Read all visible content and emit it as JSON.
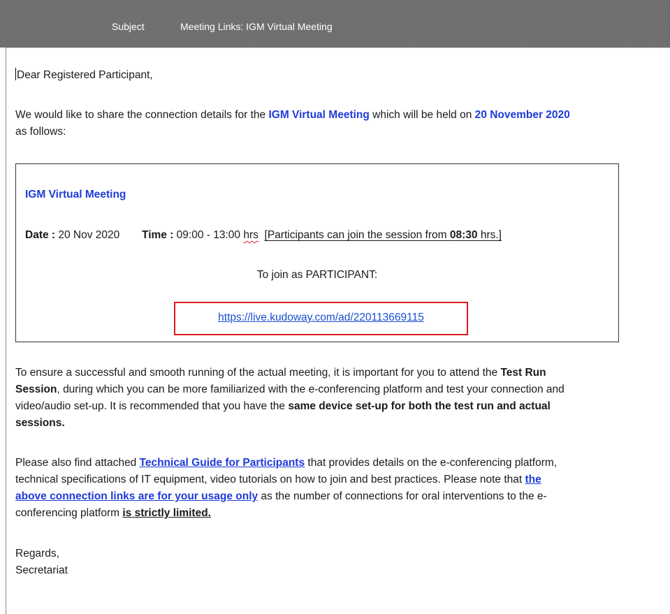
{
  "header": {
    "subject_label": "Subject",
    "subject_value": "Meeting Links: IGM Virtual Meeting"
  },
  "email": {
    "greeting": "Dear Registered Participant,",
    "intro": {
      "part1": "We would like to share the connection details for the ",
      "meeting_name": "IGM Virtual Meeting",
      "part2": " which will be held on ",
      "date": "20 November 2020",
      "part3": "as follows:"
    },
    "box": {
      "title": "IGM Virtual Meeting",
      "date_label": "Date :",
      "date_value": " 20 Nov 2020",
      "time_label": "Time :",
      "time_value": " 09:00 - 13:00 ",
      "time_unit": "hrs",
      "note_prefix": "[Participants can join the session from ",
      "note_time": "08:30",
      "note_suffix": " hrs.]",
      "join_label": "To join as PARTICIPANT:",
      "join_url": "https://live.kudoway.com/ad/220113669115"
    },
    "para2": {
      "line1_a": "To ensure a successful and smooth running of the actual meeting, it is important for you to attend the ",
      "line1_b": "Test Run",
      "line2_a": "Session",
      "line2_b": ", during which you can be more familiarized with the e-conferencing platform and test your connection and",
      "line3_a": "video/audio set-up. It is recommended that you have the ",
      "line3_b": "same device set-up for both the test run and actual",
      "line4": "sessions."
    },
    "para3": {
      "line1_a": "Please also find attached ",
      "line1_link": "Technical Guide for Participants",
      "line1_b": " that provides details on the e-conferencing platform,",
      "line2_a": "technical specifications of IT equipment, video tutorials on how to join and best practices.  Please note that ",
      "line2_link": "the",
      "line3_link": "above connection links are for your usage only",
      "line3_b": " as the number of connections for oral interventions to the e-",
      "line4_a": "conferencing platform ",
      "line4_b": "is strictly limited."
    },
    "closing": "Regards,",
    "signature": "Secretariat"
  }
}
